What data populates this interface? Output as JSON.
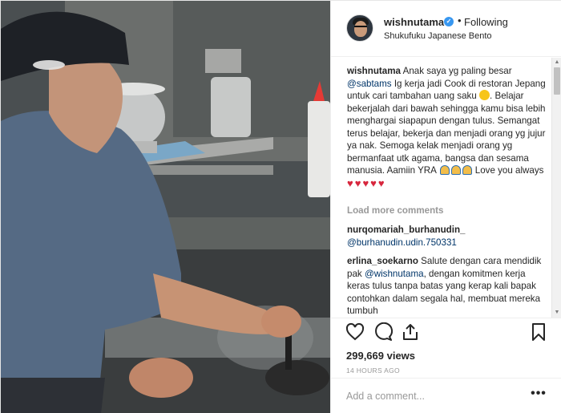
{
  "header": {
    "username": "wishnutama",
    "dot": "•",
    "follow_status": "Following",
    "location": "Shukufuku Japanese Bento"
  },
  "caption": {
    "username": "wishnutama",
    "text_1": "Anak saya yg paling besar",
    "mention": "@sabtams",
    "text_2": "Ig kerja jadi Cook di restoran Jepang untuk cari tambahan uang saku",
    "text_3": ". Belajar bekerjalah dari bawah sehingga kamu bisa lebih menghargai siapapun dengan tulus. Semangat terus belajar, bekerja dan menjadi orang yg jujur ya nak. Semoga kelak menjadi orang yg bermanfaat utk agama, bangsa dan sesama manusia. Aamiin YRA",
    "text_4": "Love you always",
    "emoji_1": "smiling-face-emoji",
    "emoji_2": "praying-hands-emoji",
    "emoji_3": "heart-emoji"
  },
  "load_more": "Load more comments",
  "comments": [
    {
      "username": "nurqomariah_burhanudin_",
      "mention": "@burhanudin.udin.750331",
      "text": ""
    },
    {
      "username": "erlina_soekarno",
      "text_1": "Salute dengan cara mendidik pak",
      "mention": "@wishnutama",
      "text_2": ", dengan komitmen kerja keras tulus tanpa batas yang kerap kali bapak contohkan dalam segala hal, membuat mereka tumbuh"
    }
  ],
  "actions": {
    "like_icon": "heart-outline-icon",
    "comment_icon": "comment-bubble-icon",
    "share_icon": "share-upload-icon",
    "save_icon": "bookmark-icon"
  },
  "views": "299,669 views",
  "timestamp": "14 HOURS AGO",
  "add_comment": {
    "placeholder": "Add a comment...",
    "more_label": "•••"
  },
  "colors": {
    "link": "#003569",
    "verified": "#3897f0",
    "muted": "#999999",
    "heart": "#d7263d"
  }
}
